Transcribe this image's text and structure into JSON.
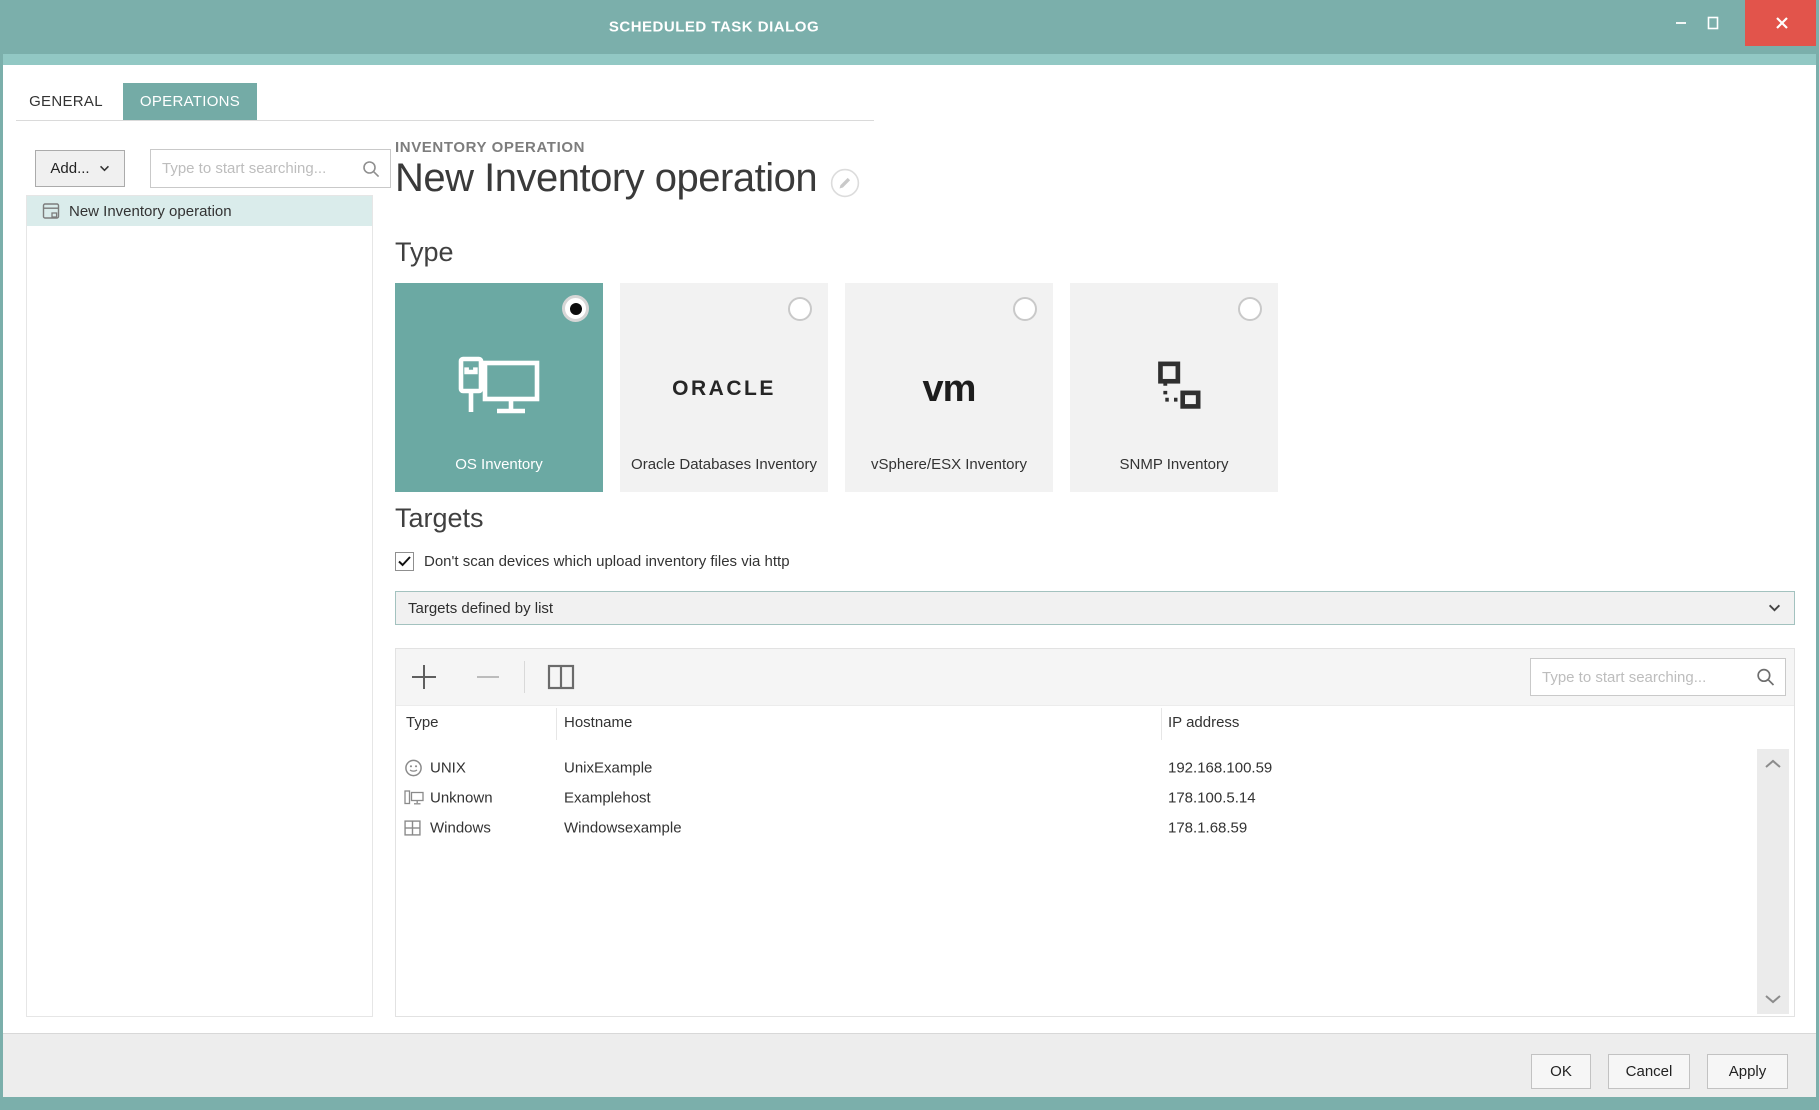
{
  "window": {
    "title": "SCHEDULED TASK DIALOG"
  },
  "tabs": {
    "general": "GENERAL",
    "operations": "OPERATIONS",
    "active": "OPERATIONS"
  },
  "sidebar": {
    "add_button_label": "Add...",
    "search_placeholder": "Type to start searching...",
    "tree_item_label": "New Inventory operation",
    "tree_item_selected": true
  },
  "main": {
    "eyebrow": "INVENTORY OPERATION",
    "title": "New Inventory operation",
    "type_heading": "Type",
    "cards": {
      "os": {
        "label": "OS Inventory",
        "selected": true
      },
      "oracle": {
        "label": "Oracle Databases Inventory",
        "logo_text": "ORACLE",
        "selected": false
      },
      "vsphere": {
        "label": "vSphere/ESX Inventory",
        "logo_text": "vm",
        "selected": false
      },
      "snmp": {
        "label": "SNMP Inventory",
        "selected": false
      }
    },
    "targets_heading": "Targets",
    "checkbox_label": "Don't scan devices which upload inventory files via http",
    "checkbox_checked": true,
    "targets_mode_value": "Targets defined by list",
    "table_search_placeholder": "Type to start searching...",
    "table": {
      "columns": {
        "type": "Type",
        "hostname": "Hostname",
        "ip": "IP address"
      },
      "rows": [
        {
          "type": "UNIX",
          "hostname": "UnixExample",
          "ip": "192.168.100.59"
        },
        {
          "type": "Unknown",
          "hostname": "Examplehost",
          "ip": "178.100.5.14"
        },
        {
          "type": "Windows",
          "hostname": "Windowsexample",
          "ip": "178.1.68.59"
        }
      ]
    }
  },
  "footer": {
    "ok": "OK",
    "cancel": "Cancel",
    "apply": "Apply"
  },
  "colors": {
    "titlebar": "#7bafab",
    "accent_tab": "#74aba6",
    "selected_card": "#6ba9a3",
    "close_button": "#e2544b",
    "tree_selection": "#daeceb",
    "footer_bg": "#ededed"
  }
}
